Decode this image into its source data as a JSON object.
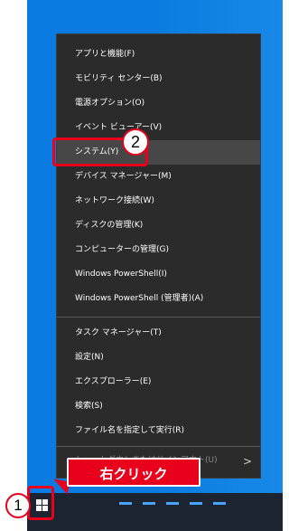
{
  "menu": {
    "items": [
      {
        "label": "アプリと機能(F)"
      },
      {
        "label": "モビリティ センター(B)"
      },
      {
        "label": "電源オプション(O)"
      },
      {
        "label": "イベント ビューアー(V)"
      },
      {
        "label": "システム(Y)"
      },
      {
        "label": "デバイス マネージャー(M)"
      },
      {
        "label": "ネットワーク接続(W)"
      },
      {
        "label": "ディスクの管理(K)"
      },
      {
        "label": "コンピューターの管理(G)"
      },
      {
        "label": "Windows PowerShell(I)"
      },
      {
        "label": "Windows PowerShell (管理者)(A)"
      },
      {
        "label": "タスク マネージャー(T)"
      },
      {
        "label": "設定(N)"
      },
      {
        "label": "エクスプローラー(E)"
      },
      {
        "label": "検索(S)"
      },
      {
        "label": "ファイル名を指定して実行(R)"
      }
    ],
    "highlighted": "システム(Y)",
    "partial_item": "シャットダウンまたはサインアウト(U)",
    "submenu_arrow": ">"
  },
  "annotations": {
    "step1": "1",
    "step2": "2",
    "callout": "右クリック",
    "color": "#e8001c"
  },
  "taskbar": {
    "start_icon": "windows-logo-icon"
  }
}
